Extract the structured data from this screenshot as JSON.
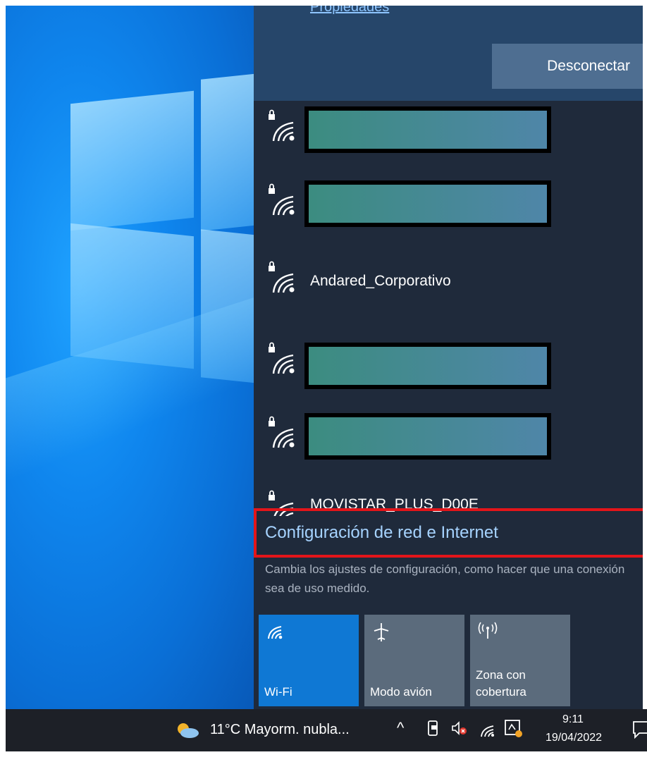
{
  "flyout": {
    "properties_link": "Propiedades",
    "disconnect_label": "Desconectar",
    "networks": [
      {
        "name": "",
        "redacted": true,
        "secured": true
      },
      {
        "name": "",
        "redacted": true,
        "secured": true
      },
      {
        "name": "Andared_Corporativo",
        "redacted": false,
        "secured": true
      },
      {
        "name": "",
        "redacted": true,
        "secured": true
      },
      {
        "name": "",
        "redacted": true,
        "secured": true
      },
      {
        "name": "MOVISTAR_PLUS_D00E",
        "redacted": false,
        "secured": true
      }
    ],
    "settings_link": "Configuración de red e Internet",
    "settings_description": "Cambia los ajustes de configuración, como hacer que una conexión sea de uso medido.",
    "tiles": [
      {
        "label": "Wi-Fi",
        "icon": "wifi-icon",
        "active": true
      },
      {
        "label": "Modo avión",
        "icon": "airplane-icon",
        "active": false
      },
      {
        "label": "Zona con cobertura",
        "icon": "hotspot-icon",
        "active": false
      }
    ]
  },
  "taskbar": {
    "weather": "11°C  Mayorm. nubla...",
    "time": "9:11",
    "date": "19/04/2022"
  },
  "colors": {
    "flyout_bg": "#1f2a3b",
    "accent": "#0f78d4",
    "highlight_border": "#e3151a",
    "link": "#a6d3ff"
  }
}
